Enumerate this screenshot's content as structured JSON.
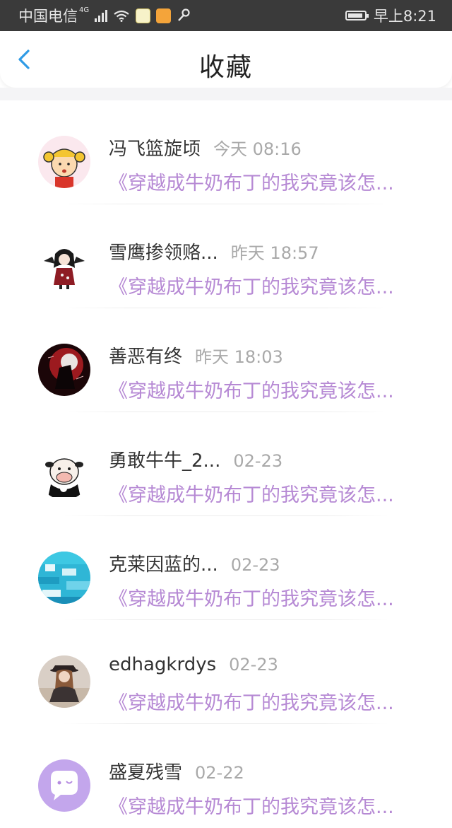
{
  "status_bar": {
    "carrier": "中国电信",
    "network": "4G",
    "time": "早上8:21"
  },
  "header": {
    "title": "收藏",
    "back_icon": "chevron-left-icon",
    "accent": "#2f9be6"
  },
  "items": [
    {
      "name": "冯飞篮旋顷",
      "time": "今天 08:16",
      "preview": "《穿越成牛奶布丁的我究竟该怎..."
    },
    {
      "name": "雪鹰掺领赂...",
      "time": "昨天 18:57",
      "preview": "《穿越成牛奶布丁的我究竟该怎..."
    },
    {
      "name": "善恶有终",
      "time": "昨天 18:03",
      "preview": "《穿越成牛奶布丁的我究竟该怎..."
    },
    {
      "name": "勇敢牛牛_2...",
      "time": "02-23",
      "preview": "《穿越成牛奶布丁的我究竟该怎..."
    },
    {
      "name": "克莱因蓝的...",
      "time": "02-23",
      "preview": "《穿越成牛奶布丁的我究竟该怎..."
    },
    {
      "name": "edhagkrdys",
      "time": "02-23",
      "preview": "《穿越成牛奶布丁的我究竟该怎..."
    },
    {
      "name": "盛夏残雪",
      "time": "02-22",
      "preview": "《穿越成牛奶布丁的我究竟该怎..."
    }
  ],
  "colors": {
    "name_text": "#333333",
    "time_text": "#a9a9a9",
    "preview_text": "#b689d4"
  }
}
